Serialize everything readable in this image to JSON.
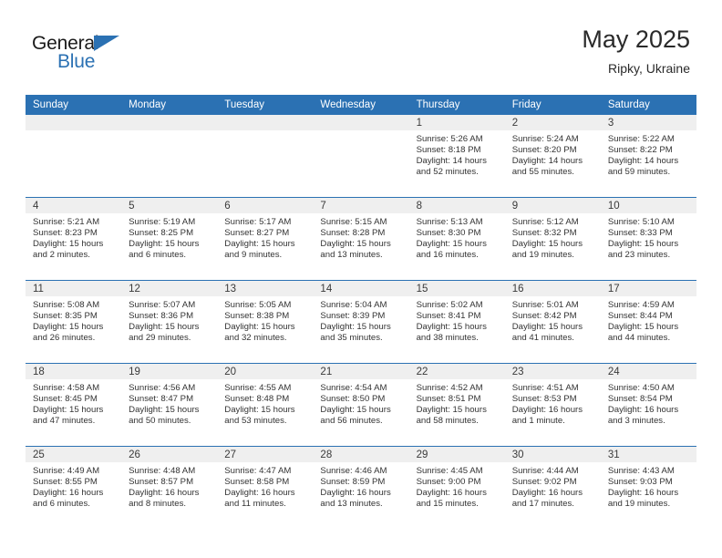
{
  "brand": {
    "name_top": "General",
    "name_bottom": "Blue",
    "triangle_icon": "triangle-icon",
    "accent_color": "#2B71B3"
  },
  "header": {
    "title": "May 2025",
    "subtitle": "Ripky, Ukraine"
  },
  "calendar": {
    "weekday_headers": [
      "Sunday",
      "Monday",
      "Tuesday",
      "Wednesday",
      "Thursday",
      "Friday",
      "Saturday"
    ],
    "header_bg": "#2B71B3",
    "daynum_band_bg": "#efefef",
    "weeks": [
      [
        {
          "day": "",
          "empty": true
        },
        {
          "day": "",
          "empty": true
        },
        {
          "day": "",
          "empty": true
        },
        {
          "day": "",
          "empty": true
        },
        {
          "day": "1",
          "sunrise": "Sunrise: 5:26 AM",
          "sunset": "Sunset: 8:18 PM",
          "daylight": "Daylight: 14 hours and 52 minutes."
        },
        {
          "day": "2",
          "sunrise": "Sunrise: 5:24 AM",
          "sunset": "Sunset: 8:20 PM",
          "daylight": "Daylight: 14 hours and 55 minutes."
        },
        {
          "day": "3",
          "sunrise": "Sunrise: 5:22 AM",
          "sunset": "Sunset: 8:22 PM",
          "daylight": "Daylight: 14 hours and 59 minutes."
        }
      ],
      [
        {
          "day": "4",
          "sunrise": "Sunrise: 5:21 AM",
          "sunset": "Sunset: 8:23 PM",
          "daylight": "Daylight: 15 hours and 2 minutes."
        },
        {
          "day": "5",
          "sunrise": "Sunrise: 5:19 AM",
          "sunset": "Sunset: 8:25 PM",
          "daylight": "Daylight: 15 hours and 6 minutes."
        },
        {
          "day": "6",
          "sunrise": "Sunrise: 5:17 AM",
          "sunset": "Sunset: 8:27 PM",
          "daylight": "Daylight: 15 hours and 9 minutes."
        },
        {
          "day": "7",
          "sunrise": "Sunrise: 5:15 AM",
          "sunset": "Sunset: 8:28 PM",
          "daylight": "Daylight: 15 hours and 13 minutes."
        },
        {
          "day": "8",
          "sunrise": "Sunrise: 5:13 AM",
          "sunset": "Sunset: 8:30 PM",
          "daylight": "Daylight: 15 hours and 16 minutes."
        },
        {
          "day": "9",
          "sunrise": "Sunrise: 5:12 AM",
          "sunset": "Sunset: 8:32 PM",
          "daylight": "Daylight: 15 hours and 19 minutes."
        },
        {
          "day": "10",
          "sunrise": "Sunrise: 5:10 AM",
          "sunset": "Sunset: 8:33 PM",
          "daylight": "Daylight: 15 hours and 23 minutes."
        }
      ],
      [
        {
          "day": "11",
          "sunrise": "Sunrise: 5:08 AM",
          "sunset": "Sunset: 8:35 PM",
          "daylight": "Daylight: 15 hours and 26 minutes."
        },
        {
          "day": "12",
          "sunrise": "Sunrise: 5:07 AM",
          "sunset": "Sunset: 8:36 PM",
          "daylight": "Daylight: 15 hours and 29 minutes."
        },
        {
          "day": "13",
          "sunrise": "Sunrise: 5:05 AM",
          "sunset": "Sunset: 8:38 PM",
          "daylight": "Daylight: 15 hours and 32 minutes."
        },
        {
          "day": "14",
          "sunrise": "Sunrise: 5:04 AM",
          "sunset": "Sunset: 8:39 PM",
          "daylight": "Daylight: 15 hours and 35 minutes."
        },
        {
          "day": "15",
          "sunrise": "Sunrise: 5:02 AM",
          "sunset": "Sunset: 8:41 PM",
          "daylight": "Daylight: 15 hours and 38 minutes."
        },
        {
          "day": "16",
          "sunrise": "Sunrise: 5:01 AM",
          "sunset": "Sunset: 8:42 PM",
          "daylight": "Daylight: 15 hours and 41 minutes."
        },
        {
          "day": "17",
          "sunrise": "Sunrise: 4:59 AM",
          "sunset": "Sunset: 8:44 PM",
          "daylight": "Daylight: 15 hours and 44 minutes."
        }
      ],
      [
        {
          "day": "18",
          "sunrise": "Sunrise: 4:58 AM",
          "sunset": "Sunset: 8:45 PM",
          "daylight": "Daylight: 15 hours and 47 minutes."
        },
        {
          "day": "19",
          "sunrise": "Sunrise: 4:56 AM",
          "sunset": "Sunset: 8:47 PM",
          "daylight": "Daylight: 15 hours and 50 minutes."
        },
        {
          "day": "20",
          "sunrise": "Sunrise: 4:55 AM",
          "sunset": "Sunset: 8:48 PM",
          "daylight": "Daylight: 15 hours and 53 minutes."
        },
        {
          "day": "21",
          "sunrise": "Sunrise: 4:54 AM",
          "sunset": "Sunset: 8:50 PM",
          "daylight": "Daylight: 15 hours and 56 minutes."
        },
        {
          "day": "22",
          "sunrise": "Sunrise: 4:52 AM",
          "sunset": "Sunset: 8:51 PM",
          "daylight": "Daylight: 15 hours and 58 minutes."
        },
        {
          "day": "23",
          "sunrise": "Sunrise: 4:51 AM",
          "sunset": "Sunset: 8:53 PM",
          "daylight": "Daylight: 16 hours and 1 minute."
        },
        {
          "day": "24",
          "sunrise": "Sunrise: 4:50 AM",
          "sunset": "Sunset: 8:54 PM",
          "daylight": "Daylight: 16 hours and 3 minutes."
        }
      ],
      [
        {
          "day": "25",
          "sunrise": "Sunrise: 4:49 AM",
          "sunset": "Sunset: 8:55 PM",
          "daylight": "Daylight: 16 hours and 6 minutes."
        },
        {
          "day": "26",
          "sunrise": "Sunrise: 4:48 AM",
          "sunset": "Sunset: 8:57 PM",
          "daylight": "Daylight: 16 hours and 8 minutes."
        },
        {
          "day": "27",
          "sunrise": "Sunrise: 4:47 AM",
          "sunset": "Sunset: 8:58 PM",
          "daylight": "Daylight: 16 hours and 11 minutes."
        },
        {
          "day": "28",
          "sunrise": "Sunrise: 4:46 AM",
          "sunset": "Sunset: 8:59 PM",
          "daylight": "Daylight: 16 hours and 13 minutes."
        },
        {
          "day": "29",
          "sunrise": "Sunrise: 4:45 AM",
          "sunset": "Sunset: 9:00 PM",
          "daylight": "Daylight: 16 hours and 15 minutes."
        },
        {
          "day": "30",
          "sunrise": "Sunrise: 4:44 AM",
          "sunset": "Sunset: 9:02 PM",
          "daylight": "Daylight: 16 hours and 17 minutes."
        },
        {
          "day": "31",
          "sunrise": "Sunrise: 4:43 AM",
          "sunset": "Sunset: 9:03 PM",
          "daylight": "Daylight: 16 hours and 19 minutes."
        }
      ]
    ]
  }
}
